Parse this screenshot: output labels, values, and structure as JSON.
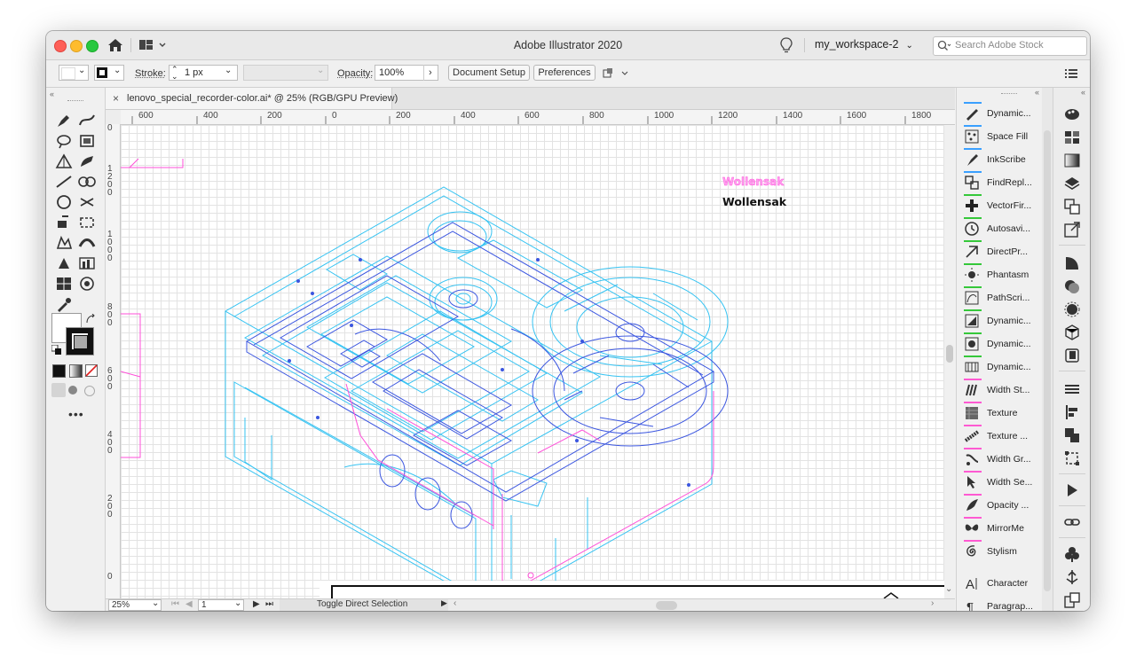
{
  "app": {
    "title": "Adobe Illustrator 2020",
    "workspace": "my_workspace-2",
    "search_placeholder": "Search Adobe Stock"
  },
  "control_bar": {
    "stroke_label": "Stroke:",
    "stroke_value": "1 px",
    "opacity_label": "Opacity:",
    "opacity_value": "100%",
    "document_setup": "Document Setup",
    "preferences": "Preferences"
  },
  "document": {
    "tab_name": "lenovo_special_recorder-color.ai* @ 25% (RGB/GPU Preview)",
    "close_glyph": "×"
  },
  "ruler": {
    "h_labels": [
      "600",
      "400",
      "200",
      "0",
      "200",
      "400",
      "600",
      "800",
      "1000",
      "1200",
      "1400",
      "1600",
      "1800"
    ],
    "v_labels": [
      "0",
      "1200",
      "1000",
      "800",
      "600",
      "400",
      "200",
      "0"
    ]
  },
  "artwork": {
    "logo_pink": "Wollensak",
    "logo_black": "Wollensak"
  },
  "status_bar": {
    "zoom": "25%",
    "artboard": "1",
    "status_text": "Toggle Direct Selection"
  },
  "panel": {
    "items": [
      {
        "label": "Dynamic...",
        "icon": "brush-icon",
        "bar": "#3aa0ff"
      },
      {
        "label": "Space Fill",
        "icon": "dots-icon",
        "bar": "#3aa0ff"
      },
      {
        "label": "InkScribe",
        "icon": "pen-icon",
        "bar": "#3aa0ff"
      },
      {
        "label": "FindRepl...",
        "icon": "find-replace-icon",
        "bar": "#3aa0ff"
      },
      {
        "label": "VectorFir...",
        "icon": "plus-icon",
        "bar": "#35c83a"
      },
      {
        "label": "Autosavi...",
        "icon": "clock-icon",
        "bar": "#35c83a"
      },
      {
        "label": "DirectPr...",
        "icon": "direct-print-icon",
        "bar": "#35c83a"
      },
      {
        "label": "Phantasm",
        "icon": "sun-icon",
        "bar": "#35c83a"
      },
      {
        "label": "PathScri...",
        "icon": "path-script-icon",
        "bar": "#35c83a"
      },
      {
        "label": "Dynamic...",
        "icon": "dynamic-shape-icon",
        "bar": "#35c83a"
      },
      {
        "label": "Dynamic...",
        "icon": "dynamic-frame-icon",
        "bar": "#35c83a"
      },
      {
        "label": "Dynamic...",
        "icon": "dynamic-measure-icon",
        "bar": "#35c83a"
      },
      {
        "label": "Width St...",
        "icon": "width-stroke-icon",
        "bar": "#ff5ad2"
      },
      {
        "label": "Texture",
        "icon": "texture-icon",
        "bar": "#ff5ad2"
      },
      {
        "label": "Texture ...",
        "icon": "texture-brush-icon",
        "bar": "#ff5ad2"
      },
      {
        "label": "Width Gr...",
        "icon": "width-gradient-icon",
        "bar": "#ff5ad2"
      },
      {
        "label": "Width Se...",
        "icon": "width-select-icon",
        "bar": "#ff5ad2"
      },
      {
        "label": "Opacity ...",
        "icon": "opacity-brush-icon",
        "bar": "#ff5ad2"
      },
      {
        "label": "MirrorMe",
        "icon": "butterfly-icon",
        "bar": "#ff5ad2"
      },
      {
        "label": "Stylism",
        "icon": "spiral-icon",
        "bar": "#ff5ad2"
      },
      {
        "label": "Character",
        "icon": "character-icon",
        "bar": ""
      },
      {
        "label": "Paragrap...",
        "icon": "paragraph-icon",
        "bar": ""
      }
    ]
  }
}
